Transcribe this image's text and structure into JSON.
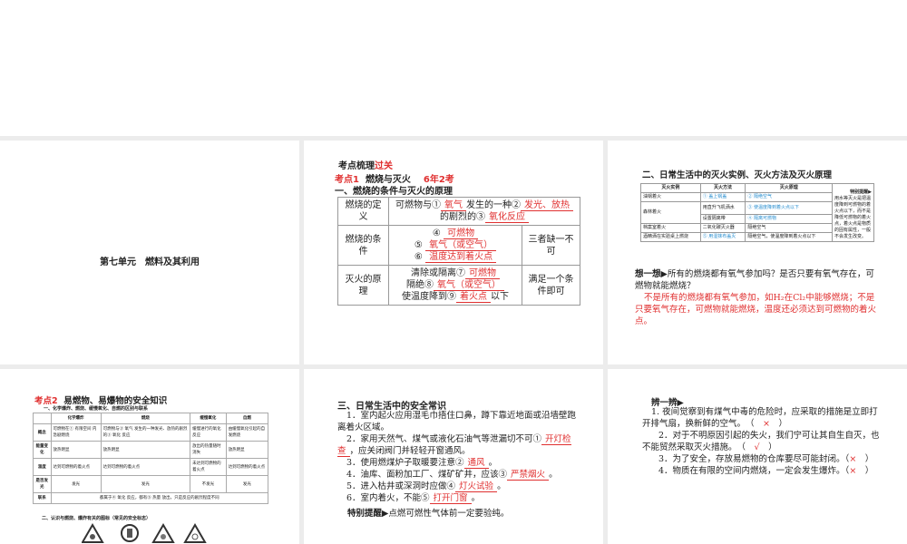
{
  "slide1": {
    "title": "第七单元　燃料及其利用"
  },
  "slide2": {
    "header_a": "考点梳理",
    "header_b": "过关",
    "kp_label": "考点1",
    "kp_title": "燃烧与灭火",
    "kp_freq": "6年2考",
    "section": "一、燃烧的条件与灭火的原理",
    "rows": [
      {
        "label": "燃烧的定义",
        "t1": "可燃物与①",
        "a1": "氧气",
        "t2": "发生的一种②",
        "a2": "发光、放热",
        "t3": "的剧烈的③",
        "a3": "氧化反应"
      },
      {
        "label": "燃烧的条件",
        "n4": "④",
        "a4": "可燃物",
        "n5": "⑤",
        "a5": "氧气（或空气）",
        "n6": "⑥",
        "a6": "温度达到着火点",
        "note": "三者缺一不可"
      },
      {
        "label": "灭火的原理",
        "t7": "清除或隔离⑦",
        "a7": "可燃物",
        "t8": "隔绝⑧",
        "a8": "氧气（或空气）",
        "t9": "使温度降到⑨",
        "a9": "着火点",
        "t9b": "以下",
        "note": "满足一个条件即可"
      }
    ]
  },
  "slide3": {
    "section": "二、日常生活中的灭火实例、灭火方法及灭火原理",
    "headers": [
      "灭火实例",
      "灭火方法",
      "灭火原理"
    ],
    "rows": [
      [
        "油锅着火",
        "① 盖上锅盖",
        "② 隔绝空气"
      ],
      [
        "森林着火",
        "用直升飞机洒水",
        "③ 使温度降到着火点以下"
      ],
      [
        "",
        "设置隔离带",
        "④ 隔离可燃物"
      ],
      [
        "档案室着火",
        "二氧化碳灭火器",
        "隔绝空气"
      ],
      [
        "酒精洒在实验桌上燃烧",
        "⑤ 用湿抹布盖灭",
        "隔绝空气，使温度降到着火点以下"
      ]
    ],
    "tip_title": "特别提醒▶",
    "tip": "用水等灭火是把温度降到可燃物的着火点以下，而不是降低可燃物的着火点，着火点是物质的固有属性，一般不会发生改变。",
    "think_label": "想一想▶",
    "think_q": "所有的燃烧都有氧气参加吗？是否只要有氧气存在，可燃物就能燃烧？",
    "think_a": "不是所有的燃烧都有氧气参加，如H₂在Cl₂中能够燃烧；不是只要氧气存在，可燃物就能燃烧，温度还必须达到可燃物的着火点。"
  },
  "slide4": {
    "kp_label": "考点2",
    "kp_title": "易燃物、易爆物的安全知识",
    "sub1": "一、化学爆炸、燃烧、缓慢氧化、自燃的区别与联系",
    "headers": [
      "",
      "化学爆炸",
      "燃烧",
      "缓慢氧化",
      "自燃"
    ],
    "rows": [
      [
        "概念",
        "可燃物在① 有限空间 内急剧燃烧",
        "可燃物与② 氧气 发生的一种发光、放热的剧烈的③ 氧化 反应",
        "缓慢进行的氧化反应",
        "由缓慢氧化引起的自发燃烧"
      ],
      [
        "能量变化",
        "放热明显",
        "放热明显",
        "放出的热量随时消失",
        "放热明显"
      ],
      [
        "温度",
        "达到可燃物的着火点",
        "达到可燃物的着火点",
        "未达到可燃物的着火点",
        "达到可燃物的着火点"
      ],
      [
        "是否发光",
        "发光",
        "发光",
        "不发光",
        "发光"
      ]
    ],
    "link_label": "联系",
    "link_text": "都属于④ 氧化 反应，都有⑤ 热量 放出，只是反应的剧烈程度不同",
    "sub2": "二、认识与燃烧、爆炸有关的图标（常见的安全标志）"
  },
  "slide5": {
    "section": "三、日常生活中的安全常识",
    "items": [
      {
        "text": "1．室内起火应用湿毛巾捂住口鼻，蹲下靠近地面或沿墙壁跑离着火区域。"
      },
      {
        "pre": "2．家用天然气、煤气或液化石油气等泄漏切不可①",
        "ans": "开灯检查",
        "post": "，应关闭阀门并轻轻开窗通风。"
      },
      {
        "pre": "3．使用燃煤炉子取暖要注意②",
        "ans": "通风",
        "post": "。"
      },
      {
        "pre": "4．油库、面粉加工厂、煤矿矿井，应该③",
        "ans": "严禁烟火",
        "post": "。"
      },
      {
        "pre": "5．进入枯井或深洞时应做④",
        "ans": "灯火试验",
        "post": "。"
      },
      {
        "pre": "6．室内着火，不能⑤",
        "ans": "打开门窗",
        "post": "。"
      }
    ],
    "tip_label": "特别提醒▶",
    "tip": "点燃可燃性气体前一定要验纯。"
  },
  "slide6": {
    "title": "辨一辨▶",
    "items": [
      {
        "text": "1. 夜间觉察到有煤气中毒的危险时，应采取的措施是立即打开排气扇，换新鲜的空气。",
        "mark": "×"
      },
      {
        "text": "2．对于不明原因引起的失火，我们宁可让其自生自灭，也不能贸然采取灭火措施。",
        "mark": "√"
      },
      {
        "text": "3．为了安全，存放易燃物的仓库要尽可能封闭。",
        "mark": "×"
      },
      {
        "text": "4．物质在有限的空间内燃烧，一定会发生爆炸。",
        "mark": "×"
      }
    ]
  }
}
